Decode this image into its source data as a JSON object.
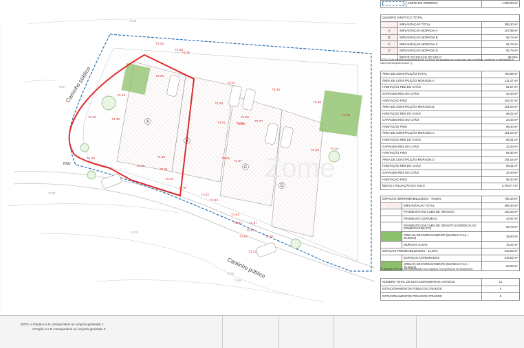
{
  "legend": {
    "limit_label": "LIMITE DO TERRENO",
    "limit_value": "1.000,00 m²"
  },
  "quadro": {
    "title": "QUADRO SINÓTICO TOTAL",
    "rows": [
      {
        "key": "",
        "label": "IMPLANTAÇÃO TOTAL",
        "value": "385,30 m²"
      },
      {
        "key": "A",
        "label": "IMPLANTAÇÃO MORADIA A",
        "value": "107,58 m²"
      },
      {
        "key": "B",
        "label": "IMPLANTAÇÃO MORADIA B",
        "value": "92,74 m²"
      },
      {
        "key": "C",
        "label": "IMPLANTAÇÃO MORADIA C",
        "value": "92,74 m²"
      },
      {
        "key": "D",
        "label": "IMPLANTAÇÃO MORADIA D",
        "value": "92,74 m²"
      },
      {
        "key": "",
        "label": "ÍNDICE OCUPAÇÃO DO SOLO",
        "value": "38,53%"
      }
    ],
    "note": "NOTA: Está incluída a implantação de 24.43m2 de garagem em cada uma das moradias, conforme a delimitação a traço interrompido a azul (          )."
  },
  "construcao": [
    {
      "label": "ÁREA DE CONSTRUÇÃO TOTAL",
      "value": "784,59 m²"
    },
    {
      "label": "ÁREA DE CONSTRUÇÃO MORADIA A",
      "value": "211,47 m²"
    },
    {
      "label": "HABITAÇÃO RÉS DO CHÃO",
      "value": "82,67 m²"
    },
    {
      "label": "GARAGEM RÉS DO CHÃO",
      "value": "24,43 m²"
    },
    {
      "label": "HABITAÇÃO PISO",
      "value": "104,37 m²"
    },
    {
      "label": "ÁREA DE CONSTRUÇÃO MORADIA B",
      "value": "191,04 m²"
    },
    {
      "label": "HABITAÇÃO RÉS DO CHÃO",
      "value": "68,31 m²"
    },
    {
      "label": "GARAGEM RÉS DO CHÃO",
      "value": "24,43 m²"
    },
    {
      "label": "HABITAÇÃO PISO",
      "value": "98,30 m²"
    },
    {
      "label": "ÁREA DE CONSTRUÇÃO MORADIA C",
      "value": "191,04 m²"
    },
    {
      "label": "HABITAÇÃO RÉS DO CHÃO",
      "value": "68,31 m²"
    },
    {
      "label": "GARAGEM RÉS DO CHÃO",
      "value": "24,43 m²"
    },
    {
      "label": "HABITAÇÃO PISO",
      "value": "98,30 m²"
    },
    {
      "label": "ÁREA DE CONSTRUÇÃO MORADIA D",
      "value": "191,04 m²"
    },
    {
      "label": "HABITAÇÃO RÉS DO CHÃO",
      "value": "68,31 m²"
    },
    {
      "label": "GARAGEM RÉS DO CHÃO",
      "value": "24,43 m²"
    },
    {
      "label": "HABITAÇÃO PISO",
      "value": "98,30 m²"
    },
    {
      "label": "ÍNDICE UTILIZAÇÃO DO SOLO",
      "value": "0,78 m² / m²"
    }
  ],
  "espacos": [
    {
      "label": "ESPAÇOS IMPERMEABILIZADOS - 75,65%",
      "value": "756,48 m²",
      "indent": 0,
      "swatch": ""
    },
    {
      "label": "IMPLANTAÇÃO TOTAL",
      "value": "385,30 m²",
      "indent": 1,
      "swatch": "red"
    },
    {
      "label": "PAVIMENTO EM CUBO DE GRANITO",
      "value": "184,28 m²",
      "indent": 1,
      "swatch": ""
    },
    {
      "label": "PAVIMENTO CERÂMICO",
      "value": "44,97 m²",
      "indent": 1,
      "swatch": ""
    },
    {
      "label": "PAVIMENTO EM CUBO DE GRANITO (CEDÊNCIA AO DOMÍNIO PÚBLICO)",
      "value": "94,79 m²",
      "indent": 1,
      "swatch": ""
    },
    {
      "label": "GRELHA DE ENRELVAMENTO (56,00m2 X 0,5 = 28,00m2)",
      "value": "28,00 m²",
      "indent": 1,
      "swatch": "green"
    },
    {
      "label": "MUROS E GUIAS",
      "value": "19,22 m²",
      "indent": 1,
      "swatch": ""
    },
    {
      "label": "ESPAÇOS PERMEABILIZADOS - 24,35%",
      "value": "243,52 m²",
      "indent": 0,
      "swatch": ""
    },
    {
      "label": "ESPAÇOS AJARDINADOS",
      "value": "215,52 m²",
      "indent": 1,
      "swatch": ""
    },
    {
      "label": "GRELHA DE ENRELVAMENTO (56,00m2 X 0,5 = 28,00m2)",
      "value": "28,00 m²",
      "indent": 1,
      "swatch": "green"
    }
  ],
  "espacos_note": "(É aplicado 50% de permeabilização nos espaços com grelha de enrelvamento)",
  "estacionamentos": [
    {
      "label": "NÚMERO TOTAL DE ESTACIONAMENTOS CRIADOS",
      "value": "12"
    },
    {
      "label": "ESTACIONAMENTOS PÚBLICOS CRIADOS",
      "value": "4"
    },
    {
      "label": "ESTACIONAMENTOS PRIVADOS CRIADOS",
      "value": "8"
    }
  ],
  "footer": {
    "note1": "NOTA: A Fração A e B correspondem ao conjunto geminado 1",
    "note2": "A Fração C e D correspondem ao conjunto geminado 2"
  },
  "plan": {
    "street_top": "Caminho público",
    "street_bottom": "Caminho público",
    "lots": [
      "A",
      "B",
      "C",
      "D"
    ],
    "rsu": "RSU",
    "elevations": [
      "73.36",
      "73.36",
      "73.36",
      "73.38",
      "73.33",
      "73.38",
      "73.20",
      "73.20",
      "73.38",
      "73.21",
      "73.18",
      "73.02",
      "73.09",
      "72.90",
      "72.85",
      "73.02",
      "72.97",
      "73.27",
      "73.06",
      "73.33",
      "73.38",
      "73.33",
      "73.15",
      "73.02",
      "72.97",
      "72.97",
      "73.02",
      "72.84",
      "72.92",
      "72.84",
      "72.97",
      "72.97",
      "72.60",
      "73.00",
      "73.22",
      "73.38"
    ],
    "contour_labels": [
      "73.57",
      "74.64",
      "73.57",
      "74.70",
      "73.62",
      "72.56"
    ],
    "watermark": "Zome"
  }
}
